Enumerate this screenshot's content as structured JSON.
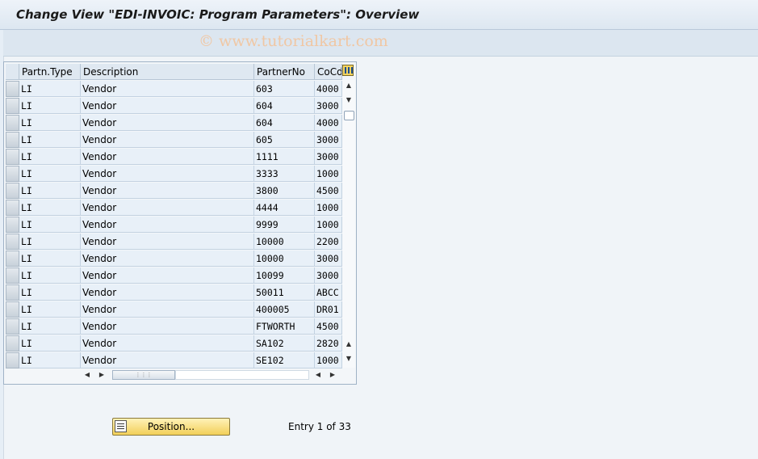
{
  "window": {
    "title": "Change View \"EDI-INVOIC: Program Parameters\": Overview"
  },
  "watermark": "© www.tutorialkart.com",
  "table": {
    "headers": {
      "partn_type": "Partn.Type",
      "description": "Description",
      "partner_no": "PartnerNo",
      "co_cd": "CoCd"
    },
    "rows": [
      {
        "type": "LI",
        "desc": "Vendor",
        "partner": "603",
        "cocd": "4000"
      },
      {
        "type": "LI",
        "desc": "Vendor",
        "partner": "604",
        "cocd": "3000"
      },
      {
        "type": "LI",
        "desc": "Vendor",
        "partner": "604",
        "cocd": "4000"
      },
      {
        "type": "LI",
        "desc": "Vendor",
        "partner": "605",
        "cocd": "3000"
      },
      {
        "type": "LI",
        "desc": "Vendor",
        "partner": "1111",
        "cocd": "3000"
      },
      {
        "type": "LI",
        "desc": "Vendor",
        "partner": "3333",
        "cocd": "1000"
      },
      {
        "type": "LI",
        "desc": "Vendor",
        "partner": "3800",
        "cocd": "4500"
      },
      {
        "type": "LI",
        "desc": "Vendor",
        "partner": "4444",
        "cocd": "1000"
      },
      {
        "type": "LI",
        "desc": "Vendor",
        "partner": "9999",
        "cocd": "1000"
      },
      {
        "type": "LI",
        "desc": "Vendor",
        "partner": "10000",
        "cocd": "2200"
      },
      {
        "type": "LI",
        "desc": "Vendor",
        "partner": "10000",
        "cocd": "3000"
      },
      {
        "type": "LI",
        "desc": "Vendor",
        "partner": "10099",
        "cocd": "3000"
      },
      {
        "type": "LI",
        "desc": "Vendor",
        "partner": "50011",
        "cocd": "ABCC"
      },
      {
        "type": "LI",
        "desc": "Vendor",
        "partner": "400005",
        "cocd": "DR01"
      },
      {
        "type": "LI",
        "desc": "Vendor",
        "partner": "FTWORTH",
        "cocd": "4500"
      },
      {
        "type": "LI",
        "desc": "Vendor",
        "partner": "SA102",
        "cocd": "2820"
      },
      {
        "type": "LI",
        "desc": "Vendor",
        "partner": "SE102",
        "cocd": "1000"
      }
    ],
    "column_settings_icon": "column-configuration-icon"
  },
  "footer": {
    "position_button_label": "Position...",
    "position_icon": "list-position-icon",
    "entry_text": "Entry 1 of 33"
  }
}
